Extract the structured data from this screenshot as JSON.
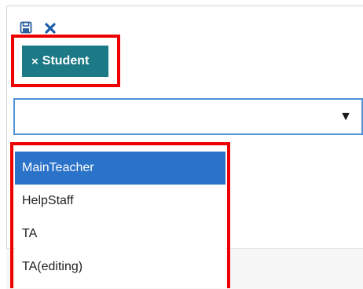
{
  "toolbar": {
    "save_icon": "save-icon",
    "close_icon": "close-icon"
  },
  "tag": {
    "remove_glyph": "×",
    "label": "Student",
    "color": "#1b7a86"
  },
  "select": {
    "value": "",
    "arrow_glyph": "▼",
    "border_color": "#4f92d6"
  },
  "dropdown": {
    "options": [
      {
        "label": "MainTeacher",
        "selected": true
      },
      {
        "label": "HelpStaff",
        "selected": false
      },
      {
        "label": "TA",
        "selected": false
      },
      {
        "label": "TA(editing)",
        "selected": false
      }
    ],
    "selected_color": "#2a73c9"
  },
  "annotation": {
    "highlight_color": "#ee0000"
  }
}
